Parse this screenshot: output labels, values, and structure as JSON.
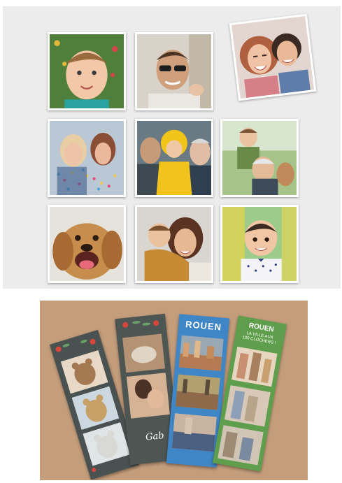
{
  "photo_grid": {
    "photos": [
      {
        "subject": "baby lying on grass with flowers"
      },
      {
        "subject": "man with sunglasses carrying child"
      },
      {
        "subject": "two girls smiling"
      },
      {
        "subject": "two women blowing confetti"
      },
      {
        "subject": "family with child in yellow raincoat"
      },
      {
        "subject": "grandfather with child on back"
      },
      {
        "subject": "dog with open mouth"
      },
      {
        "subject": "child kissing mother"
      },
      {
        "subject": "toddler smiling outdoors"
      }
    ]
  },
  "bookmarks": [
    {
      "theme": "teddy bears with floral border",
      "color": "#4a5251"
    },
    {
      "theme": "family photos with floral border",
      "color": "#4e5654",
      "caption": "Gab"
    },
    {
      "theme": "city paintings",
      "color": "#3f86c6",
      "title": "ROUEN"
    },
    {
      "theme": "city illustrations",
      "color": "#5f9e4c",
      "title": "ROUEN",
      "subtitle": "LA VILLE AUX 100 CLOCHERS !"
    }
  ],
  "colors": {
    "panel_top": "#ececec",
    "table": "#c49d7b"
  }
}
